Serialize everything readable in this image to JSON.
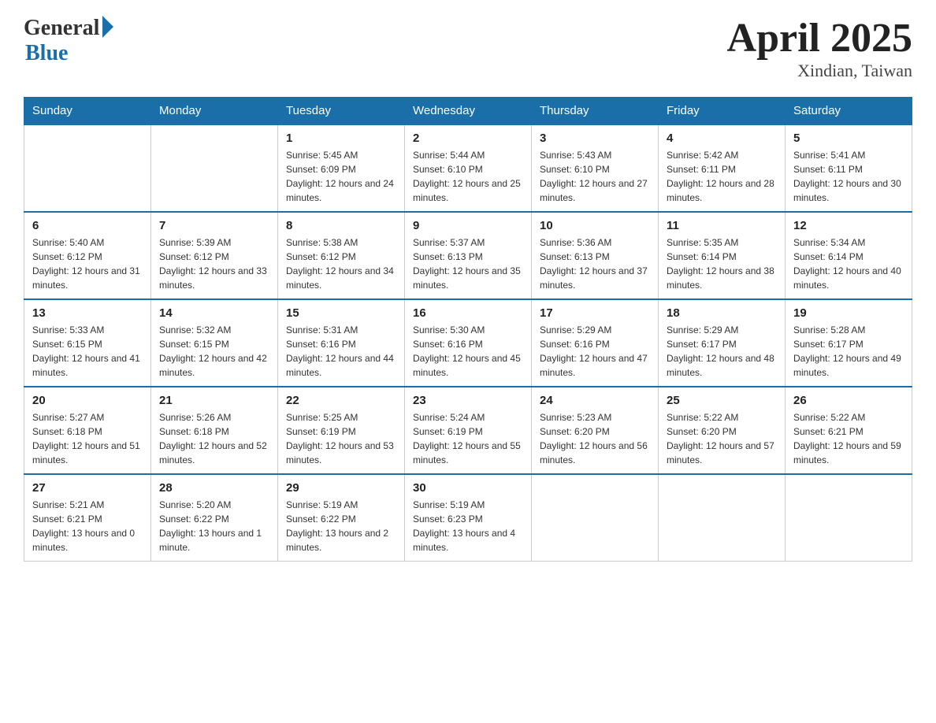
{
  "header": {
    "logo_general": "General",
    "logo_blue": "Blue",
    "month_title": "April 2025",
    "location": "Xindian, Taiwan"
  },
  "days_of_week": [
    "Sunday",
    "Monday",
    "Tuesday",
    "Wednesday",
    "Thursday",
    "Friday",
    "Saturday"
  ],
  "weeks": [
    [
      {
        "day": "",
        "sunrise": "",
        "sunset": "",
        "daylight": ""
      },
      {
        "day": "",
        "sunrise": "",
        "sunset": "",
        "daylight": ""
      },
      {
        "day": "1",
        "sunrise": "Sunrise: 5:45 AM",
        "sunset": "Sunset: 6:09 PM",
        "daylight": "Daylight: 12 hours and 24 minutes."
      },
      {
        "day": "2",
        "sunrise": "Sunrise: 5:44 AM",
        "sunset": "Sunset: 6:10 PM",
        "daylight": "Daylight: 12 hours and 25 minutes."
      },
      {
        "day": "3",
        "sunrise": "Sunrise: 5:43 AM",
        "sunset": "Sunset: 6:10 PM",
        "daylight": "Daylight: 12 hours and 27 minutes."
      },
      {
        "day": "4",
        "sunrise": "Sunrise: 5:42 AM",
        "sunset": "Sunset: 6:11 PM",
        "daylight": "Daylight: 12 hours and 28 minutes."
      },
      {
        "day": "5",
        "sunrise": "Sunrise: 5:41 AM",
        "sunset": "Sunset: 6:11 PM",
        "daylight": "Daylight: 12 hours and 30 minutes."
      }
    ],
    [
      {
        "day": "6",
        "sunrise": "Sunrise: 5:40 AM",
        "sunset": "Sunset: 6:12 PM",
        "daylight": "Daylight: 12 hours and 31 minutes."
      },
      {
        "day": "7",
        "sunrise": "Sunrise: 5:39 AM",
        "sunset": "Sunset: 6:12 PM",
        "daylight": "Daylight: 12 hours and 33 minutes."
      },
      {
        "day": "8",
        "sunrise": "Sunrise: 5:38 AM",
        "sunset": "Sunset: 6:12 PM",
        "daylight": "Daylight: 12 hours and 34 minutes."
      },
      {
        "day": "9",
        "sunrise": "Sunrise: 5:37 AM",
        "sunset": "Sunset: 6:13 PM",
        "daylight": "Daylight: 12 hours and 35 minutes."
      },
      {
        "day": "10",
        "sunrise": "Sunrise: 5:36 AM",
        "sunset": "Sunset: 6:13 PM",
        "daylight": "Daylight: 12 hours and 37 minutes."
      },
      {
        "day": "11",
        "sunrise": "Sunrise: 5:35 AM",
        "sunset": "Sunset: 6:14 PM",
        "daylight": "Daylight: 12 hours and 38 minutes."
      },
      {
        "day": "12",
        "sunrise": "Sunrise: 5:34 AM",
        "sunset": "Sunset: 6:14 PM",
        "daylight": "Daylight: 12 hours and 40 minutes."
      }
    ],
    [
      {
        "day": "13",
        "sunrise": "Sunrise: 5:33 AM",
        "sunset": "Sunset: 6:15 PM",
        "daylight": "Daylight: 12 hours and 41 minutes."
      },
      {
        "day": "14",
        "sunrise": "Sunrise: 5:32 AM",
        "sunset": "Sunset: 6:15 PM",
        "daylight": "Daylight: 12 hours and 42 minutes."
      },
      {
        "day": "15",
        "sunrise": "Sunrise: 5:31 AM",
        "sunset": "Sunset: 6:16 PM",
        "daylight": "Daylight: 12 hours and 44 minutes."
      },
      {
        "day": "16",
        "sunrise": "Sunrise: 5:30 AM",
        "sunset": "Sunset: 6:16 PM",
        "daylight": "Daylight: 12 hours and 45 minutes."
      },
      {
        "day": "17",
        "sunrise": "Sunrise: 5:29 AM",
        "sunset": "Sunset: 6:16 PM",
        "daylight": "Daylight: 12 hours and 47 minutes."
      },
      {
        "day": "18",
        "sunrise": "Sunrise: 5:29 AM",
        "sunset": "Sunset: 6:17 PM",
        "daylight": "Daylight: 12 hours and 48 minutes."
      },
      {
        "day": "19",
        "sunrise": "Sunrise: 5:28 AM",
        "sunset": "Sunset: 6:17 PM",
        "daylight": "Daylight: 12 hours and 49 minutes."
      }
    ],
    [
      {
        "day": "20",
        "sunrise": "Sunrise: 5:27 AM",
        "sunset": "Sunset: 6:18 PM",
        "daylight": "Daylight: 12 hours and 51 minutes."
      },
      {
        "day": "21",
        "sunrise": "Sunrise: 5:26 AM",
        "sunset": "Sunset: 6:18 PM",
        "daylight": "Daylight: 12 hours and 52 minutes."
      },
      {
        "day": "22",
        "sunrise": "Sunrise: 5:25 AM",
        "sunset": "Sunset: 6:19 PM",
        "daylight": "Daylight: 12 hours and 53 minutes."
      },
      {
        "day": "23",
        "sunrise": "Sunrise: 5:24 AM",
        "sunset": "Sunset: 6:19 PM",
        "daylight": "Daylight: 12 hours and 55 minutes."
      },
      {
        "day": "24",
        "sunrise": "Sunrise: 5:23 AM",
        "sunset": "Sunset: 6:20 PM",
        "daylight": "Daylight: 12 hours and 56 minutes."
      },
      {
        "day": "25",
        "sunrise": "Sunrise: 5:22 AM",
        "sunset": "Sunset: 6:20 PM",
        "daylight": "Daylight: 12 hours and 57 minutes."
      },
      {
        "day": "26",
        "sunrise": "Sunrise: 5:22 AM",
        "sunset": "Sunset: 6:21 PM",
        "daylight": "Daylight: 12 hours and 59 minutes."
      }
    ],
    [
      {
        "day": "27",
        "sunrise": "Sunrise: 5:21 AM",
        "sunset": "Sunset: 6:21 PM",
        "daylight": "Daylight: 13 hours and 0 minutes."
      },
      {
        "day": "28",
        "sunrise": "Sunrise: 5:20 AM",
        "sunset": "Sunset: 6:22 PM",
        "daylight": "Daylight: 13 hours and 1 minute."
      },
      {
        "day": "29",
        "sunrise": "Sunrise: 5:19 AM",
        "sunset": "Sunset: 6:22 PM",
        "daylight": "Daylight: 13 hours and 2 minutes."
      },
      {
        "day": "30",
        "sunrise": "Sunrise: 5:19 AM",
        "sunset": "Sunset: 6:23 PM",
        "daylight": "Daylight: 13 hours and 4 minutes."
      },
      {
        "day": "",
        "sunrise": "",
        "sunset": "",
        "daylight": ""
      },
      {
        "day": "",
        "sunrise": "",
        "sunset": "",
        "daylight": ""
      },
      {
        "day": "",
        "sunrise": "",
        "sunset": "",
        "daylight": ""
      }
    ]
  ]
}
